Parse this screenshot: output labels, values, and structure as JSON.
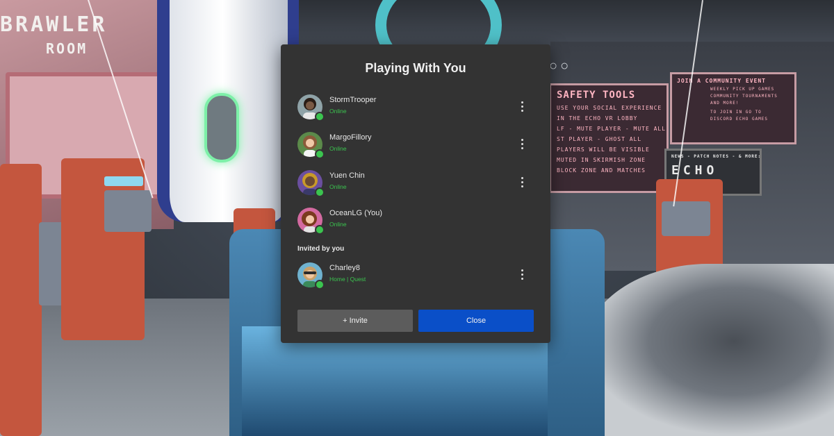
{
  "background": {
    "sign_line1": "BRAWLER",
    "sign_line2": "ROOM",
    "safety_screen": {
      "title": "SAFETY TOOLS",
      "lines": [
        "USE YOUR SOCIAL EXPERIENCE",
        "IN THE ECHO VR LOBBY",
        "LF - MUTE PLAYER - MUTE ALL",
        "ST PLAYER - GHOST ALL",
        "PLAYERS WILL BE VISIBLE",
        "MUTED IN SKIRMISH ZONE",
        "BLOCK ZONE AND MATCHES"
      ]
    },
    "event_screen": {
      "title": "JOIN A COMMUNITY EVENT",
      "lines": [
        "WEEKLY PICK UP GAMES",
        "COMMUNITY TOURNAMENTS",
        "AND MORE!",
        "TO JOIN IN GO TO",
        "DISCORD ECHO GAMES"
      ]
    },
    "news_screen": {
      "title": "NEWS - PATCH NOTES - & MORE:",
      "logo": "ECHO"
    },
    "circles": "○○"
  },
  "dialog": {
    "title": "Playing With You",
    "players": [
      {
        "name": "StormTrooper",
        "status": "Online",
        "avatar_color": "#7a5a45"
      },
      {
        "name": "MargoFillory",
        "status": "Online",
        "avatar_color": "#5b8a4a"
      },
      {
        "name": "Yuen Chin",
        "status": "Online",
        "avatar_color": "#6b4fa0"
      },
      {
        "name": "OceanLG (You)",
        "status": "Online",
        "avatar_color": "#d36aa0"
      }
    ],
    "invited_label": "Invited by you",
    "invited": [
      {
        "name": "Charley8",
        "status": "Home | Quest",
        "avatar_color": "#6fb2cf"
      }
    ],
    "invite_button": "+ Invite",
    "close_button": "Close",
    "status_color": "#3bc44f",
    "primary_color": "#0a4fc8"
  }
}
